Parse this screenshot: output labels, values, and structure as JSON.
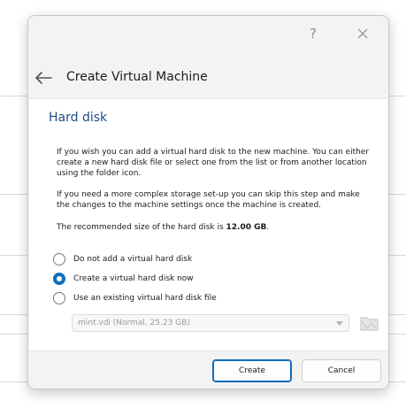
{
  "titlebar": {
    "help_glyph": "?"
  },
  "header": {
    "title": "Create Virtual Machine"
  },
  "page": {
    "title": "Hard disk",
    "paragraph1": "If you wish you can add a virtual hard disk to the new machine. You can either create a new hard disk file or select one from the list or from another location using the folder icon.",
    "paragraph2": "If you need a more complex storage set-up you can skip this step and make the changes to the machine settings once the machine is created.",
    "paragraph3_prefix": "The recommended size of the hard disk is ",
    "paragraph3_size": "12.00 GB",
    "paragraph3_suffix": "."
  },
  "options": [
    {
      "label": "Do not add a virtual hard disk",
      "checked": false
    },
    {
      "label": "Create a virtual hard disk now",
      "checked": true
    },
    {
      "label": "Use an existing virtual hard disk file",
      "checked": false
    }
  ],
  "existing_disk": {
    "selected": "mint.vdi (Normal, 25.23 GB)",
    "enabled": false
  },
  "buttons": {
    "create": "Create",
    "cancel": "Cancel"
  },
  "colors": {
    "accent": "#0f6cbd",
    "title_blue": "#1e4b87"
  },
  "icons": {
    "back": "back-arrow-icon",
    "close": "close-icon",
    "folder": "folder-icon"
  }
}
